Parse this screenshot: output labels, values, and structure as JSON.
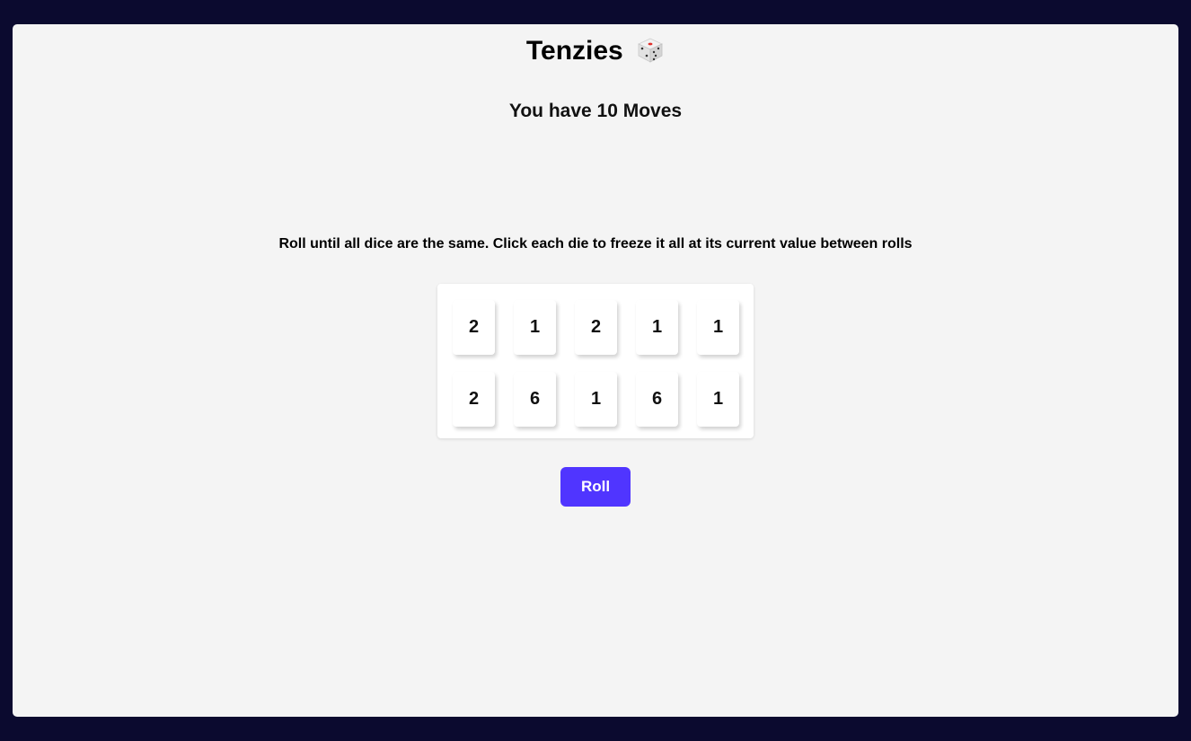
{
  "header": {
    "title": "Tenzies",
    "title_icon": "die-icon"
  },
  "moves_text": "You have 10 Moves",
  "instructions": "Roll until all dice are the same. Click each die to freeze it all at its current value between rolls",
  "dice": [
    {
      "value": "2"
    },
    {
      "value": "1"
    },
    {
      "value": "2"
    },
    {
      "value": "1"
    },
    {
      "value": "1"
    },
    {
      "value": "2"
    },
    {
      "value": "6"
    },
    {
      "value": "1"
    },
    {
      "value": "6"
    },
    {
      "value": "1"
    }
  ],
  "roll_button": {
    "label": "Roll"
  },
  "colors": {
    "background": "#0b0a2f",
    "panel": "#f4f4f4",
    "accent": "#5035ff"
  }
}
